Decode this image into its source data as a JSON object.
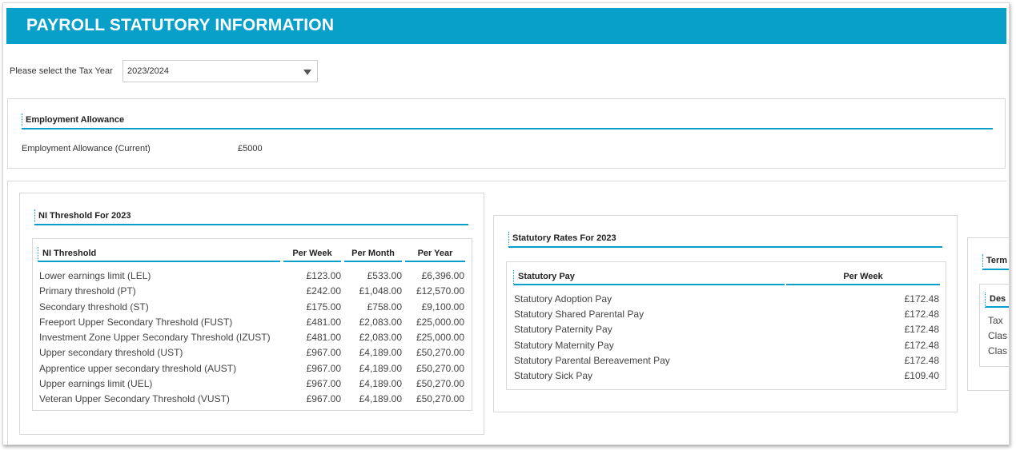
{
  "page": {
    "title": "PAYROLL STATUTORY INFORMATION"
  },
  "tax_year": {
    "label": "Please select the Tax Year",
    "selected": "2023/2024"
  },
  "employment_allowance": {
    "title": "Employment Allowance",
    "label": "Employment Allowance (Current)",
    "value": "£5000"
  },
  "ni_threshold": {
    "title": "NI Threshold For 2023",
    "headers": [
      "NI Threshold",
      "Per Week",
      "Per Month",
      "Per Year"
    ],
    "rows": [
      [
        "Lower earnings limit (LEL)",
        "£123.00",
        "£533.00",
        "£6,396.00"
      ],
      [
        "Primary threshold (PT)",
        "£242.00",
        "£1,048.00",
        "£12,570.00"
      ],
      [
        "Secondary threshold (ST)",
        "£175.00",
        "£758.00",
        "£9,100.00"
      ],
      [
        "Freeport Upper Secondary Threshold (FUST)",
        "£481.00",
        "£2,083.00",
        "£25,000.00"
      ],
      [
        "Investment Zone Upper Secondary Threshold (IZUST)",
        "£481.00",
        "£2,083.00",
        "£25,000.00"
      ],
      [
        "Upper secondary threshold (UST)",
        "£967.00",
        "£4,189.00",
        "£50,270.00"
      ],
      [
        "Apprentice upper secondary threshold (AUST)",
        "£967.00",
        "£4,189.00",
        "£50,270.00"
      ],
      [
        "Upper earnings limit (UEL)",
        "£967.00",
        "£4,189.00",
        "£50,270.00"
      ],
      [
        "Veteran Upper Secondary Threshold (VUST)",
        "£967.00",
        "£4,189.00",
        "£50,270.00"
      ]
    ]
  },
  "statutory_rates": {
    "title": "Statutory Rates For 2023",
    "headers": [
      "Statutory Pay",
      "Per Week"
    ],
    "rows": [
      [
        "Statutory Adoption Pay",
        "£172.48"
      ],
      [
        "Statutory Shared Parental Pay",
        "£172.48"
      ],
      [
        "Statutory Paternity Pay",
        "£172.48"
      ],
      [
        "Statutory Maternity Pay",
        "£172.48"
      ],
      [
        "Statutory Parental Bereavement Pay",
        "£172.48"
      ],
      [
        "Statutory Sick Pay",
        "£109.40"
      ]
    ]
  },
  "partial_panel": {
    "title": "Term",
    "header": "Des",
    "rows": [
      "Tax",
      "Clas",
      "Clas"
    ]
  }
}
